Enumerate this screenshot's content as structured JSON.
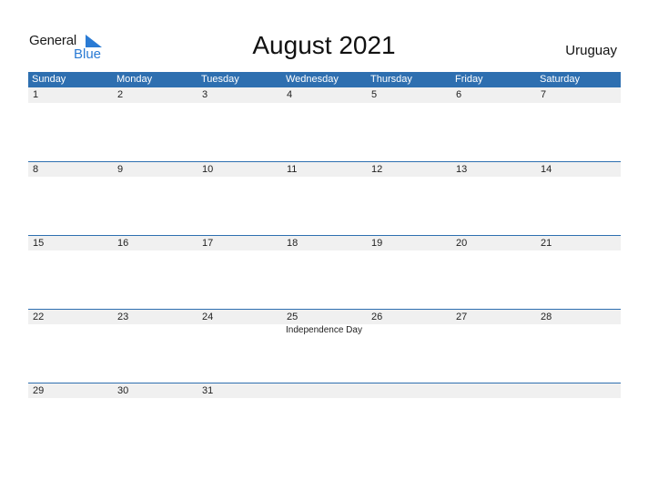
{
  "logo": {
    "general": "General",
    "blue": "Blue"
  },
  "title": "August 2021",
  "country": "Uruguay",
  "colors": {
    "header_bg": "#2e6fb0",
    "day_row_bg": "#f0f0f0",
    "logo_blue": "#2a7bd4"
  },
  "weekdays": [
    "Sunday",
    "Monday",
    "Tuesday",
    "Wednesday",
    "Thursday",
    "Friday",
    "Saturday"
  ],
  "weeks": [
    {
      "days": [
        "1",
        "2",
        "3",
        "4",
        "5",
        "6",
        "7"
      ],
      "events": [
        "",
        "",
        "",
        "",
        "",
        "",
        ""
      ]
    },
    {
      "days": [
        "8",
        "9",
        "10",
        "11",
        "12",
        "13",
        "14"
      ],
      "events": [
        "",
        "",
        "",
        "",
        "",
        "",
        ""
      ]
    },
    {
      "days": [
        "15",
        "16",
        "17",
        "18",
        "19",
        "20",
        "21"
      ],
      "events": [
        "",
        "",
        "",
        "",
        "",
        "",
        ""
      ]
    },
    {
      "days": [
        "22",
        "23",
        "24",
        "25",
        "26",
        "27",
        "28"
      ],
      "events": [
        "",
        "",
        "",
        "Independence Day",
        "",
        "",
        ""
      ]
    },
    {
      "days": [
        "29",
        "30",
        "31",
        "",
        "",
        "",
        ""
      ],
      "events": [
        "",
        "",
        "",
        "",
        "",
        "",
        ""
      ]
    }
  ]
}
